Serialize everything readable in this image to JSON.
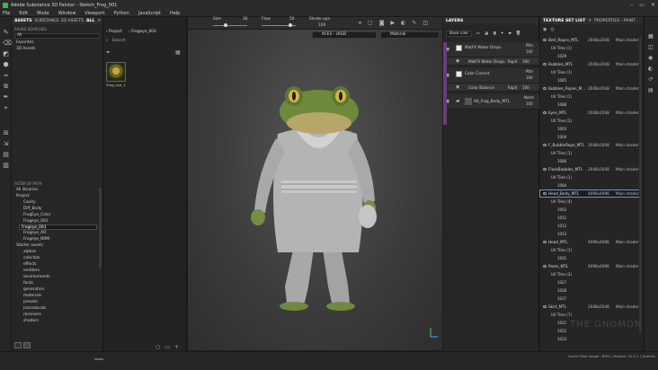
{
  "window": {
    "title": "Adobe Substance 3D Painter - Sketch_Frog_001",
    "controls": [
      "–",
      "▭",
      "✕"
    ]
  },
  "menu": [
    "File",
    "Edit",
    "Mode",
    "Window",
    "Viewport",
    "Python",
    "JavaScript",
    "Help"
  ],
  "assets_panel": {
    "tabs": [
      "ASSETS",
      "SUBSTANCE 3D ASSETS"
    ],
    "tab_all": "ALL",
    "saved_searches_label": "SAVED SEARCHES",
    "search_value": "All",
    "saved": [
      "Favorites",
      "3D Assets"
    ],
    "filter_label": "FILTER BY PATH",
    "tree": [
      "All libraries",
      "Project",
      "Cavity",
      "Diff_Body",
      "FrogEye_Color",
      "Frogeye_002",
      "Frogeye_003",
      "Frogeye_AO",
      "Frogeye_NRM",
      "Starter assets",
      "alphas",
      "colorluts",
      "effects",
      "emitters",
      "environments",
      "fonts",
      "generators",
      "materials",
      "presets",
      "procedurals",
      "receivers",
      "shaders"
    ],
    "selected_tree_item": "Frogeye_003"
  },
  "browser": {
    "breadcrumb_project": "Project",
    "breadcrumb_item": "Frogeye_003",
    "search_placeholder": "Search",
    "thumbnail_caption": "Frog_eye_1"
  },
  "viewport": {
    "size_label": "Size",
    "size_value": "30",
    "flow_label": "Flow",
    "flow_value": "50",
    "stroke_label": "Stroke opa",
    "stroke_value": "100",
    "colorspace": "ACES - sRGB",
    "channel": "Material"
  },
  "layers": {
    "title": "LAYERS",
    "blend": "Base colo",
    "items": [
      {
        "name": "MatFX Water Drops",
        "blend": "Pthr",
        "opacity": "100"
      },
      {
        "name": "MatFX Water Drops",
        "blend": "Rapit",
        "opacity": "100",
        "sub": true
      },
      {
        "name": "Color Correct",
        "blend": "Pthr",
        "opacity": "100"
      },
      {
        "name": "Color Balance",
        "blend": "Rapit",
        "opacity": "100",
        "sub": true
      },
      {
        "name": "Alt_Frog_Body_MTL",
        "blend": "Norm",
        "opacity": "100"
      }
    ]
  },
  "texture_set_list": {
    "tabs": [
      "TEXTURE SET LIST",
      "PROPERTIES - PAINT"
    ],
    "sets": [
      {
        "name": "Belt_Ropes_MTL",
        "size": "2048x2048",
        "shader": "Main shader",
        "uv": "UV Tiles (1)",
        "udims": [
          "1029"
        ]
      },
      {
        "name": "Bubbles_MTL",
        "size": "2048x2048",
        "shader": "Main shader",
        "uv": "UV Tiles (1)",
        "udims": [
          "1085"
        ]
      },
      {
        "name": "Bubbles_Ropes_M...",
        "size": "2048x2048",
        "shader": "Main shader",
        "uv": "UV Tiles (1)",
        "udims": [
          "1088"
        ]
      },
      {
        "name": "Eyes_MTL",
        "size": "2048x2048",
        "shader": "Main shader",
        "uv": "UV Tiles (2)",
        "udims": [
          "1003",
          "1004"
        ]
      },
      {
        "name": "F_BubbleRope_MTL",
        "size": "2048x2048",
        "shader": "Main shader",
        "uv": "UV Tiles (1)",
        "udims": [
          "1086"
        ]
      },
      {
        "name": "FlaskBubbles_MTL",
        "size": "2048x2048",
        "shader": "Main shader",
        "uv": "UV Tiles (1)",
        "udims": [
          "1084"
        ]
      },
      {
        "name": "Head_Body_MTL",
        "size": "4096x4096",
        "shader": "Main shader",
        "uv": "UV Tiles (4)",
        "udims": [
          "1002",
          "1011",
          "1012",
          "1013"
        ]
      },
      {
        "name": "Head_MTL",
        "size": "4096x4096",
        "shader": "Main shader",
        "uv": "UV Tiles (1)",
        "udims": [
          "1001"
        ]
      },
      {
        "name": "Pants_MTL",
        "size": "4096x4096",
        "shader": "Main shader",
        "uv": "UV Tiles (3)",
        "udims": [
          "1027",
          "1028",
          "1037"
        ]
      },
      {
        "name": "Skirt_MTL",
        "size": "2048x2048",
        "shader": "Main shader",
        "uv": "UV Tiles (7)",
        "udims": [
          "1021",
          "1022",
          "1023"
        ]
      }
    ],
    "selected": "Head_Body_MTL"
  },
  "status": {
    "cache": "Cache Disk Usage : 80% | Version: 10.0.1 | OpenGL",
    "watermark": "THE GNOMON"
  }
}
